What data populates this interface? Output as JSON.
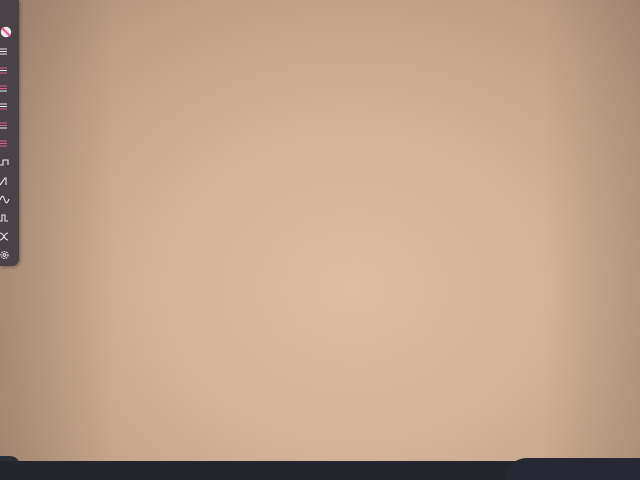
{
  "colors": {
    "toolbar_bg": "#4a4246",
    "pink_accent": "#e2589c",
    "icon_white": "#f0eaea",
    "backdrop": "#d2b398",
    "bottom_bar": "#24252d"
  },
  "toolbar": {
    "tools": [
      {
        "name": "clear-tool",
        "icon": "no-entry-circle-icon",
        "variant": "active"
      },
      {
        "name": "layer-1",
        "icon": "layers-icon",
        "variant": "white"
      },
      {
        "name": "layer-2",
        "icon": "layers-icon",
        "variant": "pink"
      },
      {
        "name": "layer-3",
        "icon": "layers-icon",
        "variant": "pink"
      },
      {
        "name": "layer-4",
        "icon": "layers-icon",
        "variant": "white"
      },
      {
        "name": "layer-5",
        "icon": "layers-icon",
        "variant": "pink"
      },
      {
        "name": "layer-6",
        "icon": "layers-icon",
        "variant": "pink"
      },
      {
        "name": "step-curve-tool",
        "icon": "step-wave-icon"
      },
      {
        "name": "ramp-tool",
        "icon": "ramp-wave-icon"
      },
      {
        "name": "sine-tool",
        "icon": "sine-wave-icon"
      },
      {
        "name": "pulse-tool",
        "icon": "pulse-wave-icon"
      },
      {
        "name": "random-tool",
        "icon": "cross-wave-icon"
      },
      {
        "name": "settings-tool",
        "icon": "gear-icon"
      }
    ]
  }
}
